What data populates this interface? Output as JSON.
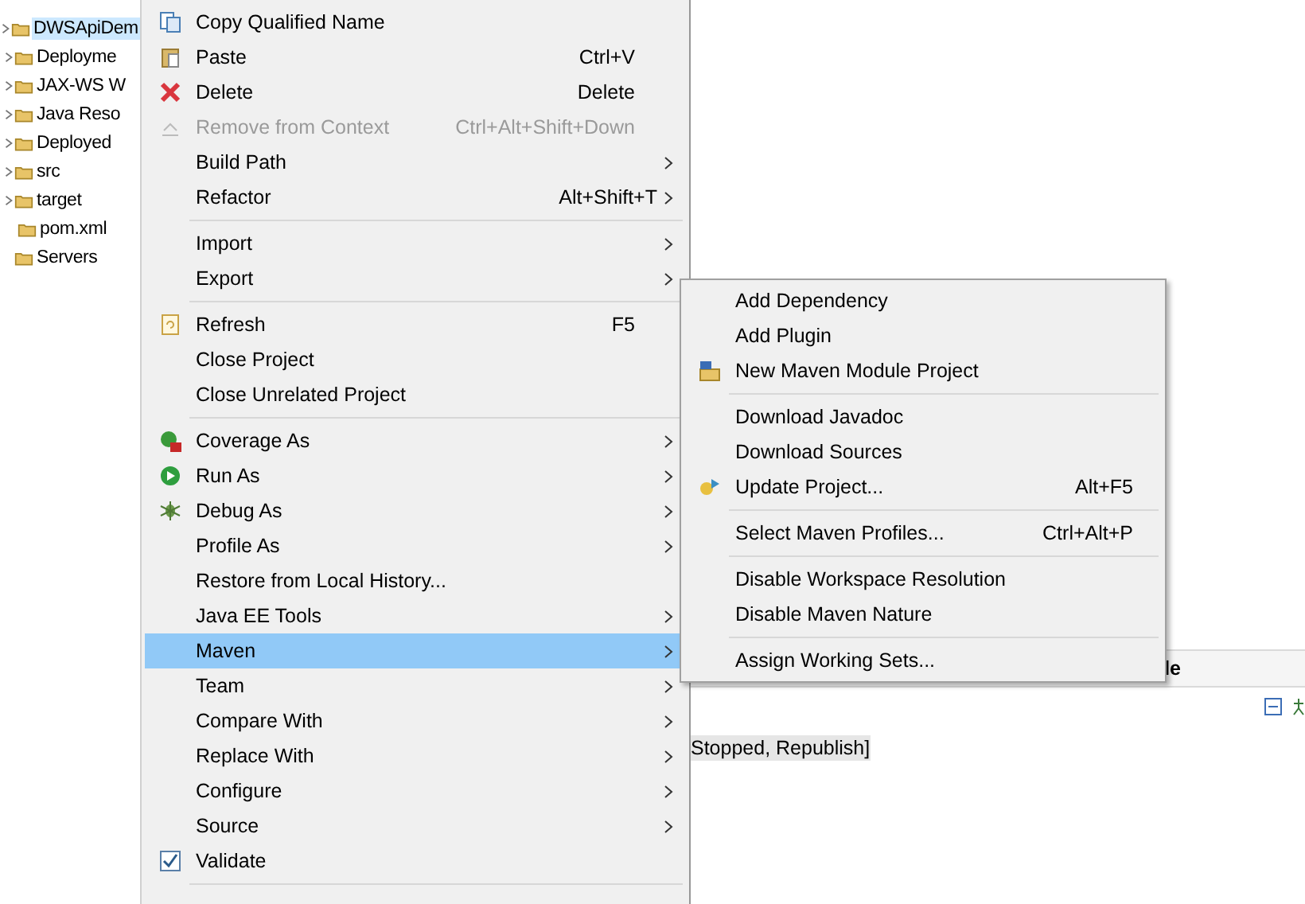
{
  "tree": [
    {
      "label": "DWSApiDem",
      "selected": true,
      "expandable": true,
      "children": [
        {
          "label": "Deployme",
          "selected": false,
          "expandable": true
        },
        {
          "label": "JAX-WS W",
          "selected": false,
          "expandable": true
        },
        {
          "label": "Java Reso",
          "selected": false,
          "expandable": true
        },
        {
          "label": "Deployed",
          "selected": false,
          "expandable": true
        },
        {
          "label": "src",
          "selected": false,
          "expandable": true
        },
        {
          "label": "target",
          "selected": false,
          "expandable": true
        },
        {
          "label": "pom.xml",
          "selected": false,
          "expandable": false
        }
      ]
    },
    {
      "label": "Servers",
      "selected": false,
      "expandable": false
    }
  ],
  "context_menu": [
    {
      "kind": "item",
      "label": "Copy Qualified Name",
      "disabled": false,
      "submenu": false,
      "selected": false
    },
    {
      "kind": "item",
      "label": "Paste",
      "shortcut": "Ctrl+V",
      "disabled": false,
      "submenu": false,
      "selected": false
    },
    {
      "kind": "item",
      "label": "Delete",
      "shortcut": "Delete",
      "disabled": false,
      "submenu": false,
      "selected": false
    },
    {
      "kind": "item",
      "label": "Remove from Context",
      "shortcut": "Ctrl+Alt+Shift+Down",
      "disabled": true,
      "submenu": false,
      "selected": false
    },
    {
      "kind": "item",
      "label": "Build Path",
      "disabled": false,
      "submenu": true,
      "selected": false
    },
    {
      "kind": "item",
      "label": "Refactor",
      "shortcut": "Alt+Shift+T",
      "disabled": false,
      "submenu": true,
      "selected": false
    },
    {
      "kind": "separator"
    },
    {
      "kind": "item",
      "label": "Import",
      "disabled": false,
      "submenu": true,
      "selected": false
    },
    {
      "kind": "item",
      "label": "Export",
      "disabled": false,
      "submenu": true,
      "selected": false
    },
    {
      "kind": "separator"
    },
    {
      "kind": "item",
      "label": "Refresh",
      "shortcut": "F5",
      "disabled": false,
      "submenu": false,
      "selected": false
    },
    {
      "kind": "item",
      "label": "Close Project",
      "disabled": false,
      "submenu": false,
      "selected": false
    },
    {
      "kind": "item",
      "label": "Close Unrelated Project",
      "disabled": false,
      "submenu": false,
      "selected": false
    },
    {
      "kind": "separator"
    },
    {
      "kind": "item",
      "label": "Coverage As",
      "disabled": false,
      "submenu": true,
      "selected": false
    },
    {
      "kind": "item",
      "label": "Run As",
      "disabled": false,
      "submenu": true,
      "selected": false
    },
    {
      "kind": "item",
      "label": "Debug As",
      "disabled": false,
      "submenu": true,
      "selected": false
    },
    {
      "kind": "item",
      "label": "Profile As",
      "disabled": false,
      "submenu": true,
      "selected": false
    },
    {
      "kind": "item",
      "label": "Restore from Local History...",
      "disabled": false,
      "submenu": false,
      "selected": false
    },
    {
      "kind": "item",
      "label": "Java EE Tools",
      "disabled": false,
      "submenu": true,
      "selected": false
    },
    {
      "kind": "item",
      "label": "Maven",
      "disabled": false,
      "submenu": true,
      "selected": true
    },
    {
      "kind": "item",
      "label": "Team",
      "disabled": false,
      "submenu": true,
      "selected": false
    },
    {
      "kind": "item",
      "label": "Compare With",
      "disabled": false,
      "submenu": true,
      "selected": false
    },
    {
      "kind": "item",
      "label": "Replace With",
      "disabled": false,
      "submenu": true,
      "selected": false
    },
    {
      "kind": "item",
      "label": "Configure",
      "disabled": false,
      "submenu": true,
      "selected": false
    },
    {
      "kind": "item",
      "label": "Source",
      "disabled": false,
      "submenu": true,
      "selected": false
    },
    {
      "kind": "item",
      "label": "Validate",
      "disabled": false,
      "submenu": false,
      "selected": false,
      "checked": true
    },
    {
      "kind": "separator"
    }
  ],
  "maven_submenu": [
    {
      "kind": "item",
      "label": "Add Dependency"
    },
    {
      "kind": "item",
      "label": "Add Plugin"
    },
    {
      "kind": "item",
      "label": "New Maven Module Project"
    },
    {
      "kind": "separator"
    },
    {
      "kind": "item",
      "label": "Download Javadoc"
    },
    {
      "kind": "item",
      "label": "Download Sources"
    },
    {
      "kind": "item",
      "label": "Update Project...",
      "shortcut": "Alt+F5"
    },
    {
      "kind": "separator"
    },
    {
      "kind": "item",
      "label": "Select Maven Profiles...",
      "shortcut": "Ctrl+Alt+P"
    },
    {
      "kind": "separator"
    },
    {
      "kind": "item",
      "label": "Disable Workspace Resolution"
    },
    {
      "kind": "item",
      "label": "Disable Maven Nature"
    },
    {
      "kind": "separator"
    },
    {
      "kind": "item",
      "label": "Assign Working Sets..."
    }
  ],
  "bottom_panel": {
    "tab_fragment": "le",
    "status_text": "Stopped, Republish]"
  }
}
